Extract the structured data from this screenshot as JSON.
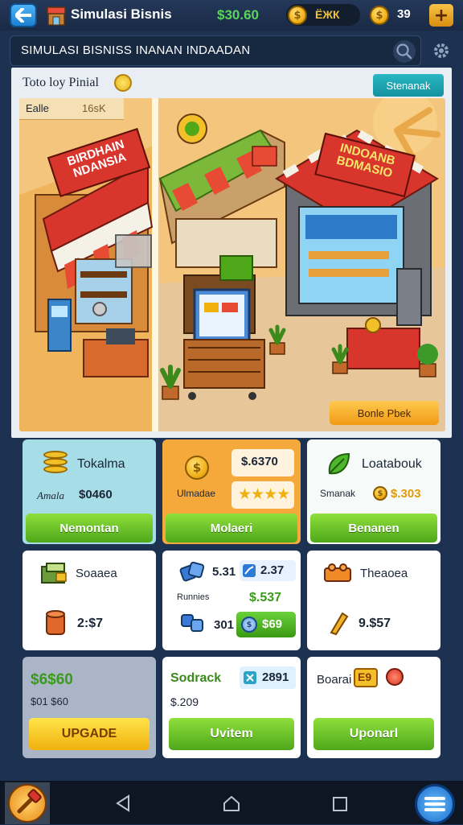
{
  "topbar": {
    "title": "Simulasi Bisnis",
    "cash": "$30.60",
    "coins": "ЁЖК",
    "gems": "39",
    "plus": "+"
  },
  "header": {
    "title": "SIMULASI BISNISS INANAN INDAADAN"
  },
  "panel": {
    "title": "Toto loy Pinial",
    "button": "Stenanak",
    "tab_left": "Ealle",
    "tab_right": "16sK",
    "sign_left": "BIRDHAIN NDANSIA",
    "sign_right": "INDOANB BDMASIO",
    "build_button": "Bonle Pbek"
  },
  "cards_row1": [
    {
      "title": "Tokalma",
      "label": "Amala",
      "value": "$0460",
      "button": "Nemontan"
    },
    {
      "title": "$.6370",
      "label": "Ulmadae",
      "stars": "★★★★",
      "button": "Molaeri"
    },
    {
      "title": "Loatabouk",
      "label": "Smanak",
      "value": "$.303",
      "button": "Benanen"
    }
  ],
  "cards_row2": [
    {
      "title": "Soaaea",
      "value": "2:$7"
    },
    {
      "value1": "5.31",
      "value2": "2.37",
      "label": "Runnies",
      "value3": "$.537",
      "value4": "301",
      "value5": "$69"
    },
    {
      "title": "Theaoea",
      "value": "9.$57"
    }
  ],
  "cards_row3": [
    {
      "line1": "$6$60",
      "line2": "$01 $60",
      "button": "UPGADE"
    },
    {
      "title": "Sodrack",
      "chip": "2891",
      "value": "$.209",
      "button": "Uvitem"
    },
    {
      "title": "Boarai",
      "chip": "E9",
      "button": "Uponarl"
    }
  ],
  "colors": {
    "background": "#1d3250",
    "green_button": "#5cb824",
    "yellow_button": "#f5c21a",
    "cash_green": "#57d65a",
    "accent_teal": "#1aa3b0"
  }
}
